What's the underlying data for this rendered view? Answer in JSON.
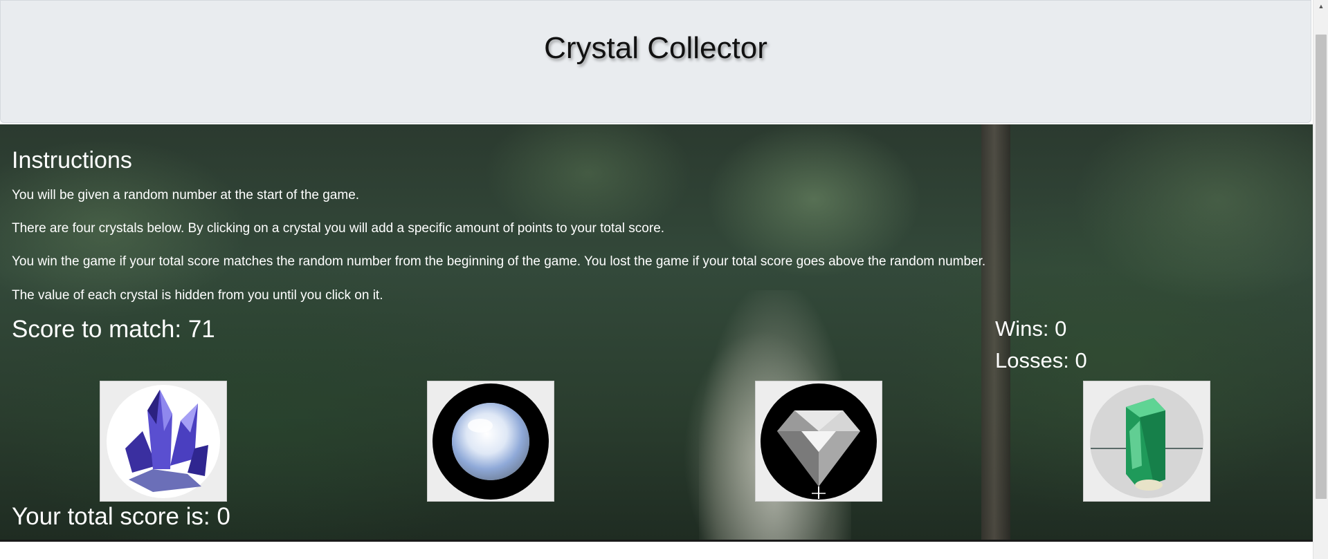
{
  "header": {
    "title": "Crystal Collector"
  },
  "instructions": {
    "heading": "Instructions",
    "lines": [
      "You will be given a random number at the start of the game.",
      "There are four crystals below. By clicking on a crystal you will add a specific amount of points to your total score.",
      "You win the game if your total score matches the random number from the beginning of the game. You lost the game if your total score goes above the random number.",
      "The value of each crystal is hidden from you until you click on it."
    ]
  },
  "game": {
    "score_to_match_label": "Score to match:",
    "score_to_match": "71",
    "wins_label": "Wins:",
    "wins": "0",
    "losses_label": "Losses:",
    "losses": "0",
    "total_score_label": "Your total score is:",
    "total_score": "0"
  },
  "crystals": [
    {
      "name": "blue-cluster-crystal-icon",
      "color": "#4b3fb8"
    },
    {
      "name": "moonstone-crystal-icon",
      "color": "#cfdcef"
    },
    {
      "name": "diamond-crystal-icon",
      "color": "#dcdcdc"
    },
    {
      "name": "emerald-crystal-icon",
      "color": "#1f9a5a"
    }
  ],
  "theme": {
    "header_bg": "#e9ecef",
    "text_on_image": "#ffffff"
  }
}
